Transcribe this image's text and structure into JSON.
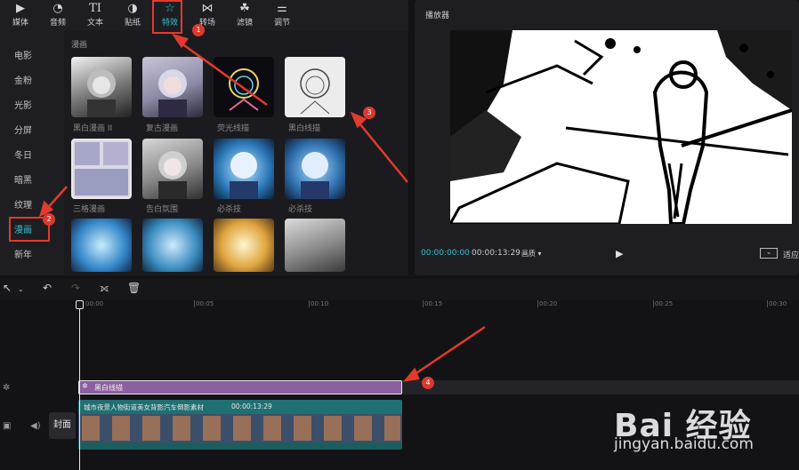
{
  "toolbar": {
    "items": [
      {
        "label": "媒体",
        "icon": "media-icon"
      },
      {
        "label": "音频",
        "icon": "audio-icon"
      },
      {
        "label": "文本",
        "icon": "text-icon"
      },
      {
        "label": "贴纸",
        "icon": "sticker-icon"
      },
      {
        "label": "特效",
        "icon": "effects-icon",
        "active": true
      },
      {
        "label": "转场",
        "icon": "transition-icon"
      },
      {
        "label": "滤镜",
        "icon": "filter-icon"
      },
      {
        "label": "调节",
        "icon": "adjust-icon"
      }
    ]
  },
  "categories": [
    "电影",
    "金粉",
    "光影",
    "分屏",
    "冬日",
    "暗黑",
    "纹理",
    "漫画",
    "新年"
  ],
  "active_category": "漫画",
  "section_title": "漫画",
  "effects": [
    {
      "name": "黑白漫画 II"
    },
    {
      "name": "复古漫画"
    },
    {
      "name": "荧光线描"
    },
    {
      "name": "黑白线描"
    },
    {
      "name": "三格漫画",
      "selected": true
    },
    {
      "name": "告白氛围"
    },
    {
      "name": "必杀技"
    },
    {
      "name": "必杀技"
    },
    {
      "name": ""
    },
    {
      "name": ""
    },
    {
      "name": ""
    },
    {
      "name": ""
    }
  ],
  "player": {
    "title": "播放器",
    "current_time": "00:00:00:00",
    "duration": "00:00:13:29",
    "quality": "画质 ▾",
    "fit_label": "适应"
  },
  "timeline": {
    "ticks": [
      "00:00",
      "00:05",
      "00:10",
      "00:15",
      "00:20",
      "00:25",
      "00:30"
    ],
    "effect_clip_label": "黑白线描",
    "video_clip_name": "城市夜景人物街道美女背影汽车倒影素材",
    "video_clip_duration": "00:00:13:29",
    "cover_label": "封面"
  },
  "annotations": [
    "1",
    "2",
    "3",
    "4"
  ],
  "watermark": {
    "brand": "Bai 经验",
    "url": "jingyan.baidu.com"
  },
  "colors": {
    "accent": "#34c2d1",
    "annotation": "#e23a2e",
    "effect_clip": "#8e5fa0",
    "video_clip": "#1f6f73"
  }
}
